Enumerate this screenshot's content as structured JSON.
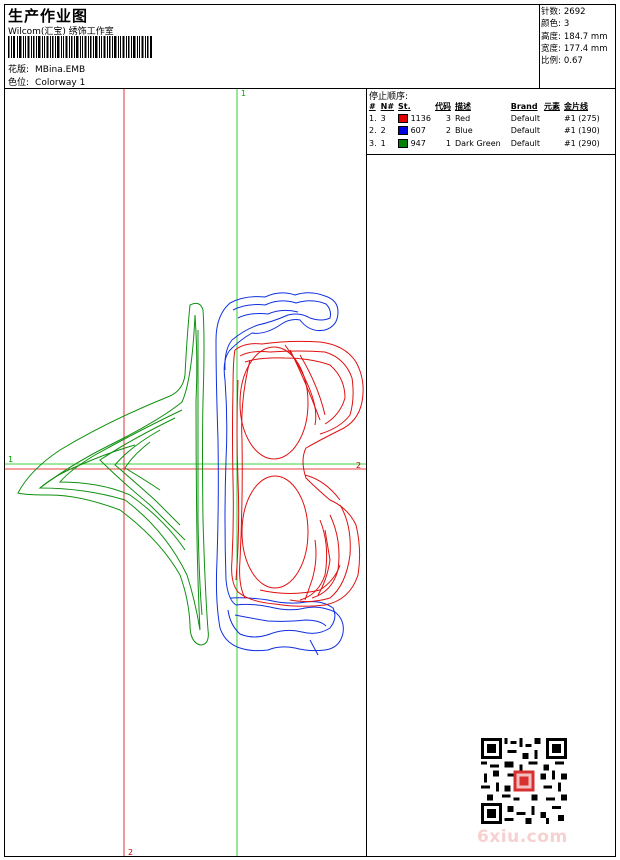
{
  "header": {
    "title": "生产作业图",
    "company": "Wilcom(汇宝) 绣饰工作室",
    "design_label": "花版:",
    "design_value": "MBina.EMB",
    "colorway_label": "色位:",
    "colorway_value": "Colorway 1"
  },
  "stats": {
    "stitches_label": "针数:",
    "stitches_value": "2692",
    "colors_label": "颜色:",
    "colors_value": "3",
    "height_label": "高度:",
    "height_value": "184.7 mm",
    "width_label": "宽度:",
    "width_value": "177.4 mm",
    "scale_label": "比例:",
    "scale_value": "0.67"
  },
  "sequence": {
    "heading": "停止顺序:",
    "columns": [
      "#",
      "N#",
      "St.",
      "代码",
      "描述",
      "Brand",
      "元素",
      "金片线"
    ],
    "rows": [
      {
        "idx": "1.",
        "n": "3",
        "color": "#e00000",
        "st": "1136",
        "code": "3",
        "desc": "Red",
        "brand": "Default",
        "elem": "#1 (275)"
      },
      {
        "idx": "2.",
        "n": "2",
        "color": "#0000e0",
        "st": "607",
        "code": "2",
        "desc": "Blue",
        "brand": "Default",
        "elem": "#1 (190)"
      },
      {
        "idx": "3.",
        "n": "1",
        "color": "#008000",
        "st": "947",
        "code": "1",
        "desc": "Dark Green",
        "brand": "Default",
        "elem": "#1 (290)"
      }
    ]
  },
  "axes": {
    "v1_top": "1",
    "v2_bottom": "2",
    "h1_left": "1",
    "h2_right": "2"
  },
  "watermark": "6xiu.com"
}
